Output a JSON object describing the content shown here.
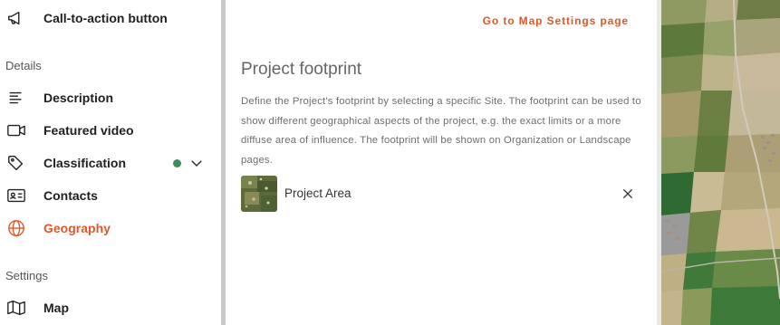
{
  "sidebar": {
    "top_item": {
      "label": "Call-to-action button",
      "icon": "megaphone-icon"
    },
    "details_heading": "Details",
    "details_items": [
      {
        "label": "Description",
        "icon": "text-lines-icon"
      },
      {
        "label": "Featured video",
        "icon": "video-icon"
      },
      {
        "label": "Classification",
        "icon": "tag-icon",
        "status": "complete"
      },
      {
        "label": "Contacts",
        "icon": "contact-card-icon"
      },
      {
        "label": "Geography",
        "icon": "globe-icon",
        "active": true
      }
    ],
    "settings_heading": "Settings",
    "settings_items": [
      {
        "label": "Map",
        "icon": "map-icon"
      }
    ]
  },
  "main": {
    "link_label": "Go to Map Settings page",
    "title": "Project footprint",
    "description": "Define the Project's footprint by selecting a specific Site. The footprint can be used to show different geographical aspects of the project, e.g. the exact limits or a more diffuse area of influence. The footprint will be shown on Organization or Landscape pages.",
    "footprint": {
      "label": "Project Area"
    }
  },
  "colors": {
    "accent": "#e0582a",
    "status_green": "#3e8e5a",
    "divider": "#c9c9c9"
  }
}
